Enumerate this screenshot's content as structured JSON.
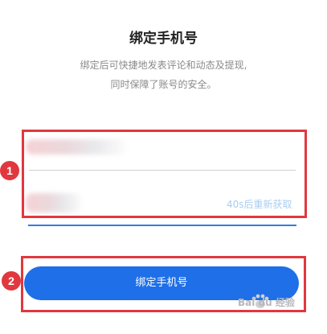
{
  "header": {
    "title": "绑定手机号",
    "description_line1": "绑定后可快捷地发表评论和动态及提现,",
    "description_line2": "同时保障了账号的安全。"
  },
  "form": {
    "phone_field": {
      "value_obscured": true
    },
    "code_field": {
      "value_obscured": true,
      "resend_label": "40s后重新获取"
    }
  },
  "submit": {
    "label": "绑定手机号"
  },
  "annotations": {
    "marker_1": "1",
    "marker_2": "2",
    "highlight_color": "#e0383e"
  },
  "colors": {
    "primary": "#1e6fe8",
    "focus_underline": "#2f7de1",
    "resend_text": "#a9cdf2"
  },
  "watermark": {
    "text": "Bai du 经验",
    "icon": "paw-icon"
  }
}
